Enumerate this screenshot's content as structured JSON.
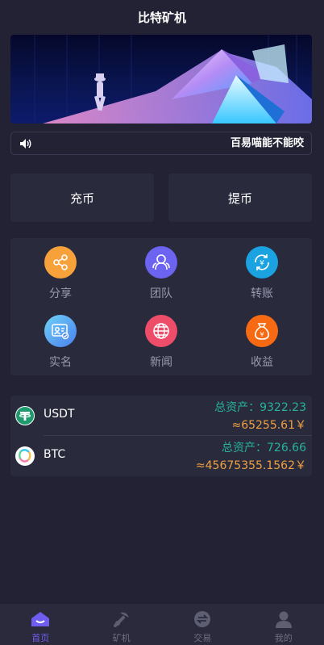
{
  "header": {
    "title": "比特矿机"
  },
  "notice": {
    "text": "百易喵能不能咬"
  },
  "actions": {
    "deposit_label": "充币",
    "withdraw_label": "提币"
  },
  "menu": [
    {
      "label": "分享",
      "icon": "share-icon",
      "color": "#f7a13a"
    },
    {
      "label": "团队",
      "icon": "team-icon",
      "color": "#6c63f0"
    },
    {
      "label": "转账",
      "icon": "transfer-icon",
      "color": "#1aa3e0"
    },
    {
      "label": "实名",
      "icon": "id-card-icon",
      "color": "#5aa8f5"
    },
    {
      "label": "新闻",
      "icon": "news-globe-icon",
      "color": "#ee4d6a"
    },
    {
      "label": "收益",
      "icon": "money-bag-icon",
      "color": "#f56a12"
    }
  ],
  "assets": [
    {
      "coin": "USDT",
      "total": "总资产：9322.23",
      "approx": "≈65255.61￥"
    },
    {
      "coin": "BTC",
      "total": "总资产：726.66",
      "approx": "≈45675355.1562￥"
    }
  ],
  "tabs": [
    {
      "label": "首页",
      "icon": "home-icon",
      "active": true
    },
    {
      "label": "矿机",
      "icon": "miner-icon",
      "active": false
    },
    {
      "label": "交易",
      "icon": "exchange-icon",
      "active": false
    },
    {
      "label": "我的",
      "icon": "user-icon",
      "active": false
    }
  ],
  "colors": {
    "accent": "#6f5df0",
    "total_green": "#26b39a",
    "approx_orange": "#f0a040"
  }
}
